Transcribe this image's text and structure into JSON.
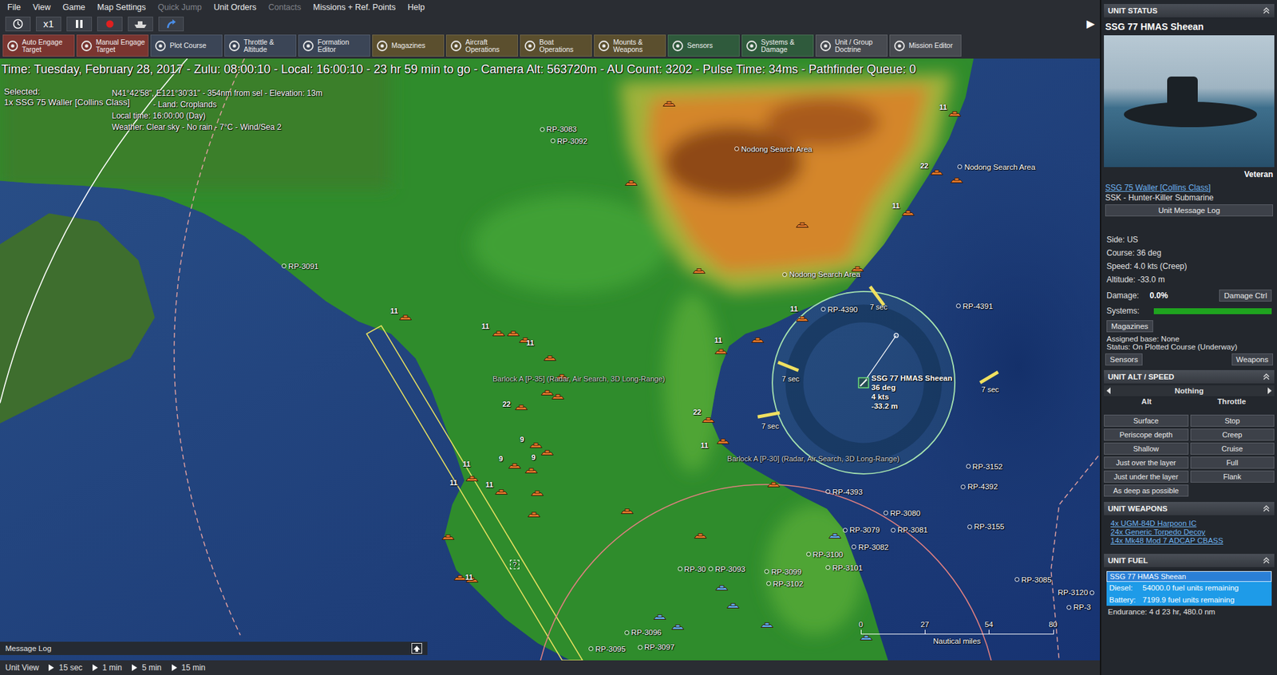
{
  "menu": [
    {
      "label": "File",
      "disabled": false
    },
    {
      "label": "View",
      "disabled": false
    },
    {
      "label": "Game",
      "disabled": false
    },
    {
      "label": "Map Settings",
      "disabled": false
    },
    {
      "label": "Quick Jump",
      "disabled": true
    },
    {
      "label": "Unit Orders",
      "disabled": false
    },
    {
      "label": "Contacts",
      "disabled": true
    },
    {
      "label": "Missions + Ref. Points",
      "disabled": false
    },
    {
      "label": "Help",
      "disabled": false
    }
  ],
  "time_controls": {
    "speed": "x1",
    "collapse": "▶"
  },
  "toolbar": [
    {
      "label": "Auto Engage Target",
      "color": "#7a3530"
    },
    {
      "label": "Manual Engage Target",
      "color": "#7a3530"
    },
    {
      "label": "Plot Course",
      "color": "#3b4556"
    },
    {
      "label": "Throttle & Altitude",
      "color": "#3b4556"
    },
    {
      "label": "Formation Editor",
      "color": "#3b4556"
    },
    {
      "label": "Magazines",
      "color": "#5b4f2e"
    },
    {
      "label": "Aircraft Operations",
      "color": "#5b4f2e"
    },
    {
      "label": "Boat Operations",
      "color": "#5b4f2e"
    },
    {
      "label": "Mounts & Weapons",
      "color": "#5b4f2e"
    },
    {
      "label": "Sensors",
      "color": "#2f5a3c"
    },
    {
      "label": "Systems & Damage",
      "color": "#2f5a3c"
    },
    {
      "label": "Unit / Group Doctrine",
      "color": "#474a50"
    },
    {
      "label": "Mission Editor",
      "color": "#474a50"
    }
  ],
  "map": {
    "time": "Time: Tuesday, February 28, 2017 - Zulu: 08:00:10 - Local: 16:00:10 - 23 hr 59 min to go - Camera Alt: 563720m - AU Count: 3202 - Pulse Time: 34ms - Pathfinder Queue: 0",
    "selected_label": "Selected:",
    "selected_unit": "1x SSG 75 Waller [Collins Class]",
    "hover": [
      "N41°42'58\", E121°30'31\" - 354nm from sel - Elevation: 13m",
      "- Land: Croplands",
      "Local time: 16:00:00 (Day)",
      "Weather: Clear sky - No rain - 7°C - Wind/Sea 2"
    ],
    "reference_points": [
      "RP-3083",
      "RP-3092",
      "RP-3091",
      "Nodong Search Area",
      "Nodong Search Area",
      "Nodong Search Area",
      "RP-4390",
      "RP-4391",
      "RP-3152",
      "RP-4392",
      "RP-4393",
      "RP-3080",
      "RP-3081",
      "RP-3079",
      "RP-3082",
      "RP-3155",
      "RP-3100",
      "RP-3101",
      "RP-3099",
      "RP-3102",
      "RP-30",
      "RP-3093",
      "RP-3096",
      "RP-3097",
      "RP-3095",
      "RP-3085",
      "RP-3120",
      "RP-3"
    ],
    "unit_counts": [
      "11",
      "22",
      "11",
      "11",
      "11",
      "11",
      "11",
      "11",
      "22",
      "22",
      "11",
      "9",
      "9",
      "9",
      "11",
      "11",
      "11",
      "11"
    ],
    "units": [
      {
        "kind": "hostile"
      },
      {
        "kind": "hostile"
      },
      {
        "kind": "hostile"
      },
      {
        "kind": "hostile"
      },
      {
        "kind": "hostile"
      },
      {
        "kind": "hostile"
      },
      {
        "kind": "hostile"
      },
      {
        "kind": "hostile"
      },
      {
        "kind": "hostile"
      },
      {
        "kind": "hostile"
      },
      {
        "kind": "hostile"
      },
      {
        "kind": "hostile"
      },
      {
        "kind": "hostile"
      },
      {
        "kind": "hostile"
      },
      {
        "kind": "hostile"
      },
      {
        "kind": "hostile"
      },
      {
        "kind": "hostile"
      },
      {
        "kind": "hostile"
      },
      {
        "kind": "hostile"
      },
      {
        "kind": "hostile"
      },
      {
        "kind": "hostile"
      },
      {
        "kind": "hostile"
      },
      {
        "kind": "hostile"
      },
      {
        "kind": "hostile"
      },
      {
        "kind": "hostile"
      },
      {
        "kind": "hostile"
      },
      {
        "kind": "hostile"
      },
      {
        "kind": "hostile"
      },
      {
        "kind": "hostile"
      },
      {
        "kind": "hostile"
      },
      {
        "kind": "hostile"
      },
      {
        "kind": "hostile"
      },
      {
        "kind": "hostile"
      },
      {
        "kind": "hostile"
      },
      {
        "kind": "hostile"
      },
      {
        "kind": "hostile"
      },
      {
        "kind": "hostile"
      },
      {
        "kind": "friendly"
      },
      {
        "kind": "friendly"
      },
      {
        "kind": "friendly"
      },
      {
        "kind": "friendly"
      },
      {
        "kind": "friendly"
      },
      {
        "kind": "friendly"
      },
      {
        "kind": "friendly"
      }
    ],
    "sensor_labels": [
      "Barlock A [P-35] (Radar, Air Search, 3D Long-Range)",
      "Barlock A [P-30] (Radar, Air Search, 3D Long-Range)"
    ],
    "sonar_timers": [
      "7 sec",
      "7 sec",
      "7 sec",
      "7 sec"
    ],
    "selected_sub": {
      "name": "SSG 77 HMAS Sheean",
      "course": "36 deg",
      "speed": "4 kts",
      "depth": "-33.2 m"
    },
    "unknown_contact": "?",
    "scale": {
      "ticks": [
        "0",
        "27",
        "54",
        "80"
      ],
      "unit": "Nautical miles"
    }
  },
  "message_log": {
    "label": "Message Log"
  },
  "time_compression": {
    "label": "Unit View",
    "steps": [
      "15 sec",
      "1 min",
      "5 min",
      "15 min"
    ]
  },
  "unit_panel": {
    "status_header": "UNIT STATUS",
    "name": "SSG 77 HMAS Sheean",
    "rank": "Veteran",
    "class_link": "SSG 75 Waller [Collins Class]",
    "type": "SSK - Hunter-Killer Submarine",
    "message_log_button": "Unit Message Log",
    "fields": [
      "Side: US",
      "Course: 36 deg",
      "Speed: 4.0 kts (Creep)",
      "Altitude: -33.0 m"
    ],
    "damage_label": "Damage:",
    "damage_value": "0.0%",
    "damage_button": "Damage Ctrl",
    "systems_label": "Systems:",
    "systems_level": 1,
    "magazines_button": "Magazines",
    "assigned_base": "Assigned base: None",
    "status": "Status: On Plotted Course (Underway)",
    "sensors_button": "Sensors",
    "weapons_button": "Weapons",
    "alt_speed_header": "UNIT ALT / SPEED",
    "preset": "Nothing",
    "alt_label": "Alt",
    "throttle_label": "Throttle",
    "alt_buttons": [
      "Surface",
      "Periscope depth",
      "Shallow",
      "Just over the layer",
      "Just under the layer",
      "As deep as possible"
    ],
    "throttle_buttons": [
      "Stop",
      "Creep",
      "Cruise",
      "Full",
      "Flank"
    ],
    "weapons_header": "UNIT WEAPONS",
    "weapons": [
      "4x UGM-84D Harpoon IC",
      "24x Generic Torpedo Decoy",
      "14x Mk48 Mod 7 ADCAP CBASS"
    ],
    "fuel_header": "UNIT FUEL",
    "fuel_units": [
      {
        "name": "SSG 77 HMAS Sheean",
        "selected": true
      }
    ],
    "fuel": [
      {
        "label": "Diesel:",
        "value": "54000.0 fuel units remaining"
      },
      {
        "label": "Battery:",
        "value": "7199.9 fuel units remaining"
      }
    ],
    "endurance": "Endurance: 4 d 23 hr, 480.0 nm"
  }
}
